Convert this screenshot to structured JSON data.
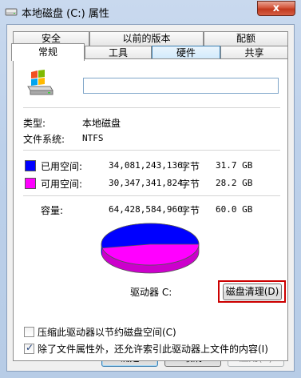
{
  "window": {
    "title": "本地磁盘 (C:) 属性",
    "close_glyph": "x"
  },
  "tabs": {
    "row_back": [
      {
        "label": "安全"
      },
      {
        "label": "以前的版本"
      },
      {
        "label": "配额"
      }
    ],
    "row_front": [
      {
        "label": "常规"
      },
      {
        "label": "工具"
      },
      {
        "label": "硬件"
      },
      {
        "label": "共享"
      }
    ]
  },
  "general": {
    "name_value": "",
    "type_label": "类型:",
    "type_value": "本地磁盘",
    "fs_label": "文件系统:",
    "fs_value": "NTFS",
    "used": {
      "label": "已用空间:",
      "bytes": "34,081,243,136",
      "unit": "字节",
      "size": "31.7 GB",
      "color": "#0000ff"
    },
    "free": {
      "label": "可用空间:",
      "bytes": "30,347,341,824",
      "unit": "字节",
      "size": "28.2 GB",
      "color": "#ff00ff"
    },
    "capacity": {
      "label": "容量:",
      "bytes": "64,428,584,960",
      "unit": "字节",
      "size": "60.0 GB"
    },
    "used_fraction": 0.529,
    "drive_label": "驱动器 C:",
    "cleanup_button": "磁盘清理(D)",
    "compress_label": "压缩此驱动器以节约磁盘空间(C)",
    "compress_checked": false,
    "index_label": "除了文件属性外，还允许索引此驱动器上文件的内容(I)",
    "index_checked": true
  },
  "buttons": {
    "ok": "确定",
    "cancel": "取消",
    "apply": "应用(A)"
  },
  "icons": {
    "title": "drive-icon",
    "drive": "drive-icon",
    "close": "close-icon",
    "checkmark": "checkmark-icon"
  }
}
